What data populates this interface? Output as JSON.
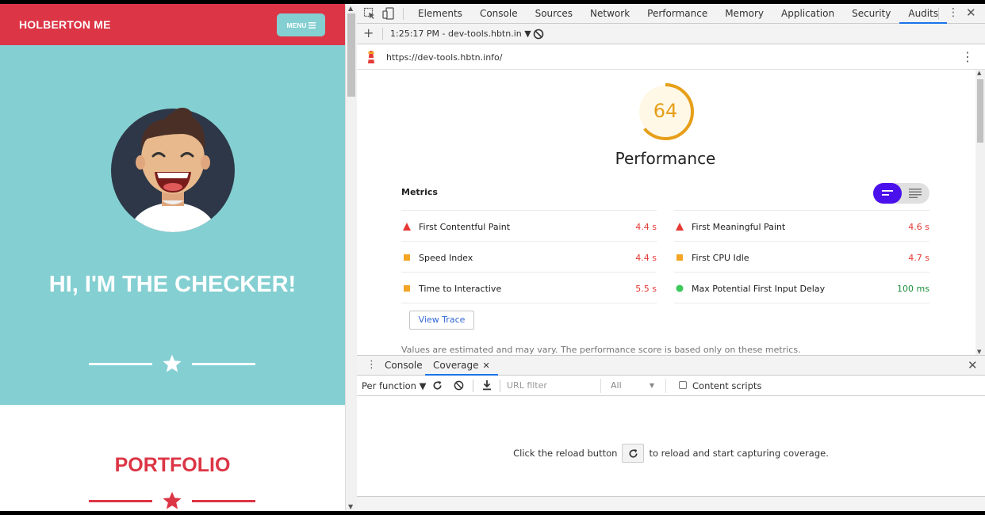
{
  "site": {
    "brand": "HOLBERTON ME",
    "menu_label": "MENU",
    "hero_title": "HI, I'M THE CHECKER!",
    "portfolio_title": "PORTFOLIO",
    "colors": {
      "nav": "#dc3545",
      "hero": "#84cfd2",
      "menu_button": "#84cfd2"
    }
  },
  "devtools": {
    "tabs": [
      "Elements",
      "Console",
      "Sources",
      "Network",
      "Performance",
      "Memory",
      "Application",
      "Security",
      "Audits"
    ],
    "active_tab": "Audits",
    "report_selector": "1:25:17 PM - dev-tools.hbtn.in ▼",
    "url": "https://dev-tools.hbtn.info/",
    "audit": {
      "score": "64",
      "score_fraction": 0.64,
      "category": "Performance",
      "metrics_heading": "Metrics",
      "metrics_left": [
        {
          "label": "First Contentful Paint",
          "value": "4.4 s",
          "status": "fail",
          "icon": "triangle-icon",
          "color": "#e53935"
        },
        {
          "label": "Speed Index",
          "value": "4.4 s",
          "status": "average",
          "icon": "square-icon",
          "color": "#f4a524"
        },
        {
          "label": "Time to Interactive",
          "value": "5.5 s",
          "status": "average",
          "icon": "square-icon",
          "color": "#f4a524"
        }
      ],
      "metrics_right": [
        {
          "label": "First Meaningful Paint",
          "value": "4.6 s",
          "status": "fail",
          "icon": "triangle-icon",
          "color": "#e53935"
        },
        {
          "label": "First CPU Idle",
          "value": "4.7 s",
          "status": "average",
          "icon": "square-icon",
          "color": "#f4a524"
        },
        {
          "label": "Max Potential First Input Delay",
          "value": "100 ms",
          "status": "pass",
          "icon": "circle-icon",
          "color": "#1e8e3e"
        }
      ],
      "view_trace_label": "View Trace",
      "disclaimer": "Values are estimated and may vary. The performance score is based only on these metrics."
    },
    "drawer": {
      "tabs": [
        "Console",
        "Coverage"
      ],
      "active_tab": "Coverage",
      "per_function": "Per function ▼",
      "url_filter_placeholder": "URL filter",
      "type_select": "All",
      "content_scripts_label": "Content scripts",
      "message_before": "Click the reload button",
      "message_after": "to reload and start capturing coverage."
    }
  }
}
